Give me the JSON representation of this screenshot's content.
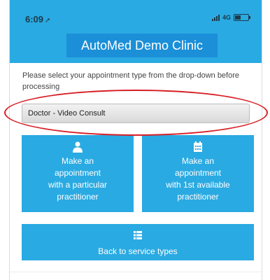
{
  "status_bar": {
    "time": "6:09",
    "location_arrow": "➚",
    "network": "4G"
  },
  "header": {
    "title": "AutoMed Demo Clinic"
  },
  "form": {
    "instructions": "Please select your appointment type from the drop-down before processing",
    "appointment_type_selected": "Doctor - Video Consult"
  },
  "tiles": {
    "particular": {
      "icon": "person-icon",
      "lines": [
        "Make an",
        "appointment",
        "with a particular",
        "practitioner"
      ]
    },
    "first_available": {
      "icon": "calendar-icon",
      "lines": [
        "Make an",
        "appointment",
        "with 1st available",
        "practitioner"
      ]
    },
    "back": {
      "icon": "list-icon",
      "lines": [
        "Back to service types"
      ]
    }
  },
  "colors": {
    "accent": "#2aaae2",
    "title_box": "#1b8fd8",
    "highlight": "#d81f26"
  }
}
